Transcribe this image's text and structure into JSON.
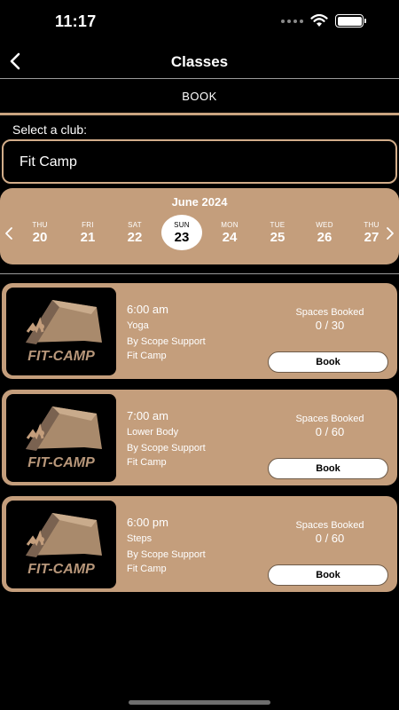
{
  "status_bar": {
    "time": "11:17"
  },
  "nav": {
    "title": "Classes",
    "back_icon": "chevron-left-icon"
  },
  "tab": {
    "label": "BOOK"
  },
  "club": {
    "label": "Select a club:",
    "value": "Fit Camp"
  },
  "calendar": {
    "month": "June 2024",
    "days": [
      {
        "dow": "THU",
        "num": "20"
      },
      {
        "dow": "FRI",
        "num": "21"
      },
      {
        "dow": "SAT",
        "num": "22"
      },
      {
        "dow": "SUN",
        "num": "23"
      },
      {
        "dow": "MON",
        "num": "24"
      },
      {
        "dow": "TUE",
        "num": "25"
      },
      {
        "dow": "WED",
        "num": "26"
      },
      {
        "dow": "THU",
        "num": "27"
      }
    ],
    "selected_index": 3
  },
  "classes": [
    {
      "time": "6:00 am",
      "name": "Yoga",
      "by": "By Scope Support",
      "club": "Fit Camp",
      "spaces_label": "Spaces Booked",
      "spaces": "0 / 30",
      "button": "Book",
      "logo_text": "FIT-CAMP"
    },
    {
      "time": "7:00 am",
      "name": "Lower Body",
      "by": "By Scope Support",
      "club": "Fit Camp",
      "spaces_label": "Spaces Booked",
      "spaces": "0 / 60",
      "button": "Book",
      "logo_text": "FIT-CAMP"
    },
    {
      "time": "6:00 pm",
      "name": "Steps",
      "by": "By Scope Support",
      "club": "Fit Camp",
      "spaces_label": "Spaces Booked",
      "spaces": "0 / 60",
      "button": "Book",
      "logo_text": "FIT-CAMP"
    }
  ],
  "colors": {
    "accent": "#c49e7c",
    "border": "#d2ad8a",
    "background": "#000000"
  }
}
